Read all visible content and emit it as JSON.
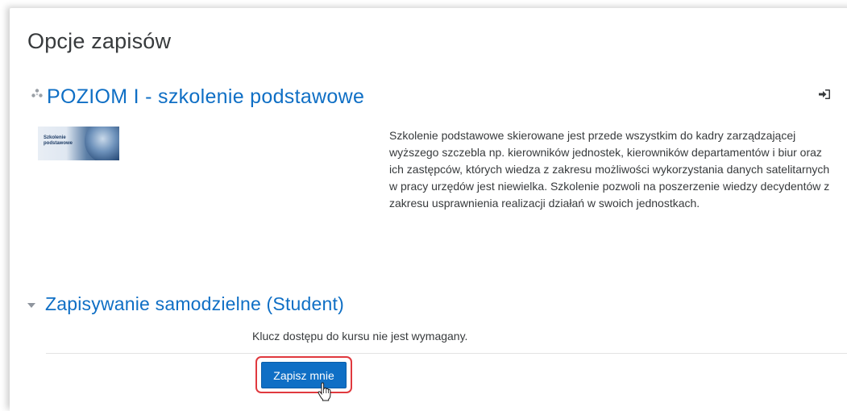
{
  "page": {
    "title": "Opcje zapisów"
  },
  "course": {
    "name": "POZIOM I - szkolenie podstawowe",
    "icon": "course-icon",
    "enrol_icon": "sign-in-icon",
    "image_text": "Szkolenie podstawowe",
    "summary": "Szkolenie podstawowe skierowane jest przede wszystkim do kadry zarządzającej wyższego szczebla np. kierowników jednostek, kierowników departamentów i biur oraz ich zastępców, których wiedza z zakresu możliwości wykorzystania danych satelitarnych w pracy urzędów jest niewielka. Szkolenie pozwoli na poszerzenie wiedzy decydentów z zakresu usprawnienia realizacji działań w swoich jednostkach."
  },
  "enrolment": {
    "section_title": "Zapisywanie samodzielne (Student)",
    "key_info": "Klucz dostępu do kursu nie jest wymagany.",
    "button_label": "Zapisz mnie"
  },
  "colors": {
    "link": "#0f6fc5",
    "button": "#0f6fc5",
    "highlight": "#e0393e",
    "text": "#373a3c"
  }
}
